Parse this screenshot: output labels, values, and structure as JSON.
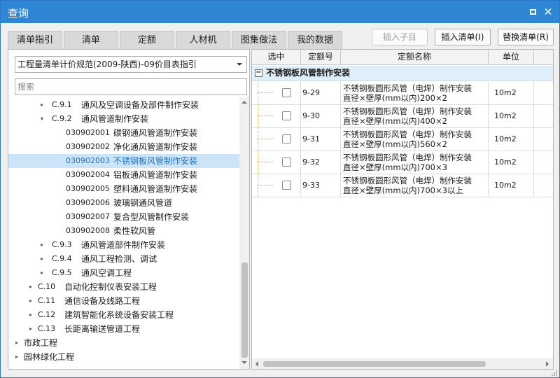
{
  "window": {
    "title": "查询"
  },
  "tabs": [
    {
      "label": "清单指引",
      "active": true
    },
    {
      "label": "清单"
    },
    {
      "label": "定额"
    },
    {
      "label": "人材机"
    },
    {
      "label": "图集做法"
    },
    {
      "label": "我的数据"
    }
  ],
  "toolbar": {
    "insert_child": "插入子目",
    "insert_list": "插入清单(I)",
    "replace_list": "替换清单(R)"
  },
  "left": {
    "spec_select": "工程量清单计价规范(2009-陕西)-09价目表指引",
    "search_placeholder": "搜索",
    "tree": [
      {
        "level": 2,
        "toggle": "▸",
        "code": "C.9.1",
        "name": "通风及空调设备及部件制作安装"
      },
      {
        "level": 2,
        "toggle": "▾",
        "code": "C.9.2",
        "name": "通风管道制作安装"
      },
      {
        "level": 3,
        "code": "030902001",
        "name": "碳钢通风管道制作安装"
      },
      {
        "level": 3,
        "code": "030902002",
        "name": "净化通风管道制作安装"
      },
      {
        "level": 3,
        "code": "030902003",
        "name": "不锈钢板风管制作安装",
        "selected": true
      },
      {
        "level": 3,
        "code": "030902004",
        "name": "铝板通风管道制作安装"
      },
      {
        "level": 3,
        "code": "030902005",
        "name": "塑料通风管道制作安装"
      },
      {
        "level": 3,
        "code": "030902006",
        "name": "玻璃钢通风管道"
      },
      {
        "level": 3,
        "code": "030902007",
        "name": "复合型风管制作安装"
      },
      {
        "level": 3,
        "code": "030902008",
        "name": "柔性软风管"
      },
      {
        "level": 2,
        "toggle": "▸",
        "code": "C.9.3",
        "name": "通风管道部件制作安装"
      },
      {
        "level": 2,
        "toggle": "▸",
        "code": "C.9.4",
        "name": "通风工程检测、调试"
      },
      {
        "level": 2,
        "toggle": "▸",
        "code": "C.9.5",
        "name": "通风空调工程"
      },
      {
        "level": 1,
        "toggle": "▸",
        "code": "C.10",
        "name": "自动化控制仪表安装工程"
      },
      {
        "level": 1,
        "toggle": "▸",
        "code": "C.11",
        "name": "通信设备及线路工程"
      },
      {
        "level": 1,
        "toggle": "▸",
        "code": "C.12",
        "name": "建筑智能化系统设备安装工程"
      },
      {
        "level": 1,
        "toggle": "▸",
        "code": "C.13",
        "name": "长距离输送管道工程"
      },
      {
        "level": 0,
        "toggle": "▸",
        "code": "",
        "name": "市政工程"
      },
      {
        "level": 0,
        "toggle": "▸",
        "code": "",
        "name": "园林绿化工程"
      }
    ]
  },
  "right": {
    "columns": [
      "选中",
      "定额号",
      "定额名称",
      "单位"
    ],
    "group": {
      "toggle": "−",
      "name": "不锈钢板风管制作安装"
    },
    "rows": [
      {
        "code": "9-29",
        "name1": "不锈钢板圆形风管（电焊）制作安装",
        "name2": "直径×壁厚(mm以内)200×2",
        "unit": "10m2"
      },
      {
        "code": "9-30",
        "name1": "不锈钢板圆形风管（电焊）制作安装",
        "name2": "直径×壁厚(mm以内)400×2",
        "unit": "10m2"
      },
      {
        "code": "9-31",
        "name1": "不锈钢板圆形风管（电焊）制作安装",
        "name2": "直径×壁厚(mm以内)560×2",
        "unit": "10m2"
      },
      {
        "code": "9-32",
        "name1": "不锈钢板圆形风管（电焊）制作安装",
        "name2": "直径×壁厚(mm以内)700×3",
        "unit": "10m2"
      },
      {
        "code": "9-33",
        "name1": "不锈钢板圆形风管（电焊）制作安装",
        "name2": "直径×壁厚(mm以内)700×3以上",
        "unit": "10m2"
      }
    ]
  },
  "icons": {
    "maximize": "maximize-icon",
    "close": "close-icon",
    "dropdown": "chevron-down-icon"
  },
  "colors": {
    "accent": "#2f86d4",
    "selection": "#cce4f7",
    "group_row": "#dfeefb"
  }
}
